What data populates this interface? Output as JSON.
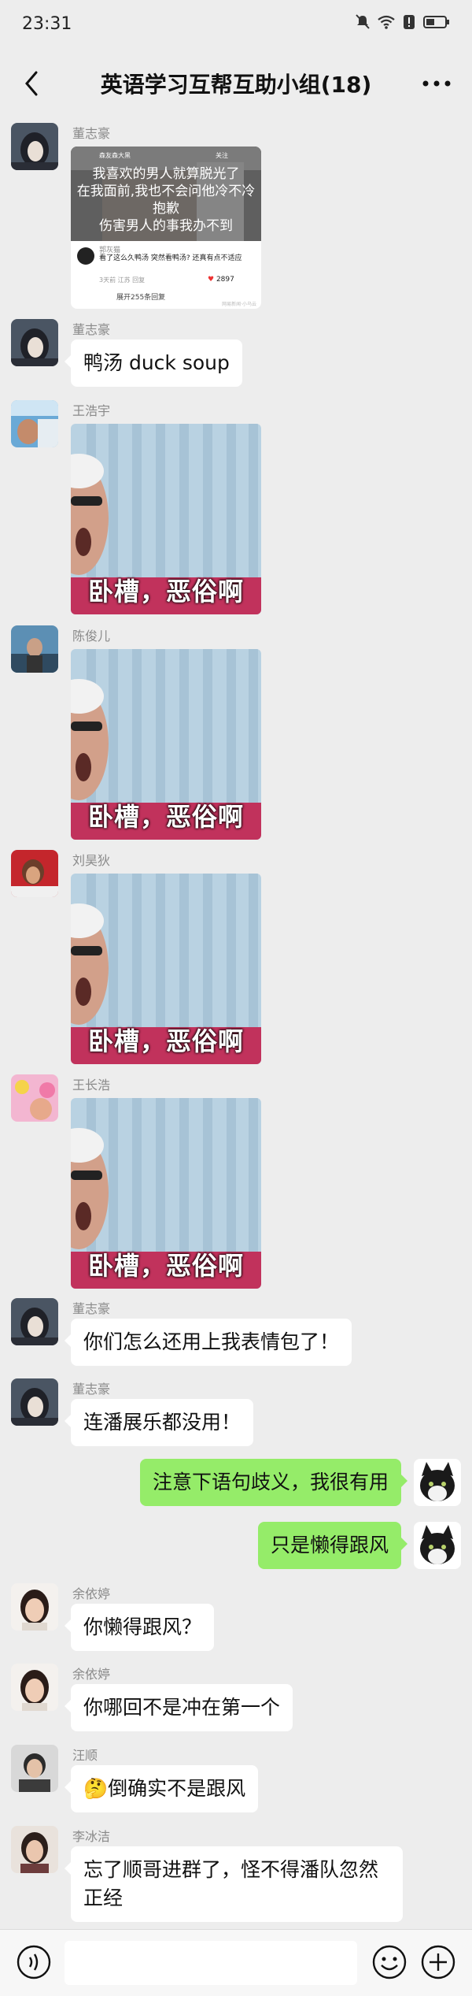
{
  "status": {
    "time": "23:31"
  },
  "header": {
    "title": "英语学习互帮互助小组(18)"
  },
  "card": {
    "topbar_left": "森友森大黑",
    "topbar_follow": "关注",
    "overlay_lines": [
      "我喜欢的男人就算脱光了",
      "在我面前,我也不会问他冷不冷",
      "抱歉",
      "伤害男人的事我办不到"
    ],
    "commenter": "郭灰猫",
    "comment": "看了这么久鸭汤 突然看鸭汤? 还真有点不适应",
    "meta": "3天前 江苏   回复",
    "likes": "2897",
    "expand": "展开255条回复",
    "watermark": "网易新闻·小乌云"
  },
  "sticker_caption": "卧槽，恶俗啊",
  "messages": [
    {
      "sender": "董志豪",
      "kind": "card"
    },
    {
      "sender": "董志豪",
      "text": "鸭汤 duck soup"
    },
    {
      "sender": "王浩宇",
      "kind": "sticker"
    },
    {
      "sender": "陈俊儿",
      "kind": "sticker"
    },
    {
      "sender": "刘昊狄",
      "kind": "sticker"
    },
    {
      "sender": "王长浩",
      "kind": "sticker"
    },
    {
      "sender": "董志豪",
      "text": "你们怎么还用上我表情包了！"
    },
    {
      "sender": "董志豪",
      "text": "连潘展乐都没用！"
    },
    {
      "sender": "",
      "text": "注意下语句歧义，我很有用"
    },
    {
      "sender": "",
      "text": "只是懒得跟风"
    },
    {
      "sender": "余依婷",
      "text": "你懒得跟风？"
    },
    {
      "sender": "余依婷",
      "text": "你哪回不是冲在第一个"
    },
    {
      "sender": "汪顺",
      "text": "倒确实不是跟风",
      "emoji": "🤔"
    },
    {
      "sender": "李冰洁",
      "text": "忘了顺哥进群了，怪不得潘队忽然正经"
    }
  ],
  "icons": {
    "back": "back-arrow-icon",
    "more": "more-dots-icon",
    "voice": "voice-icon",
    "emoji": "emoji-icon",
    "plus": "plus-icon"
  },
  "colors": {
    "background": "#ededed",
    "self_bubble": "#95ec69",
    "other_bubble": "#ffffff"
  }
}
